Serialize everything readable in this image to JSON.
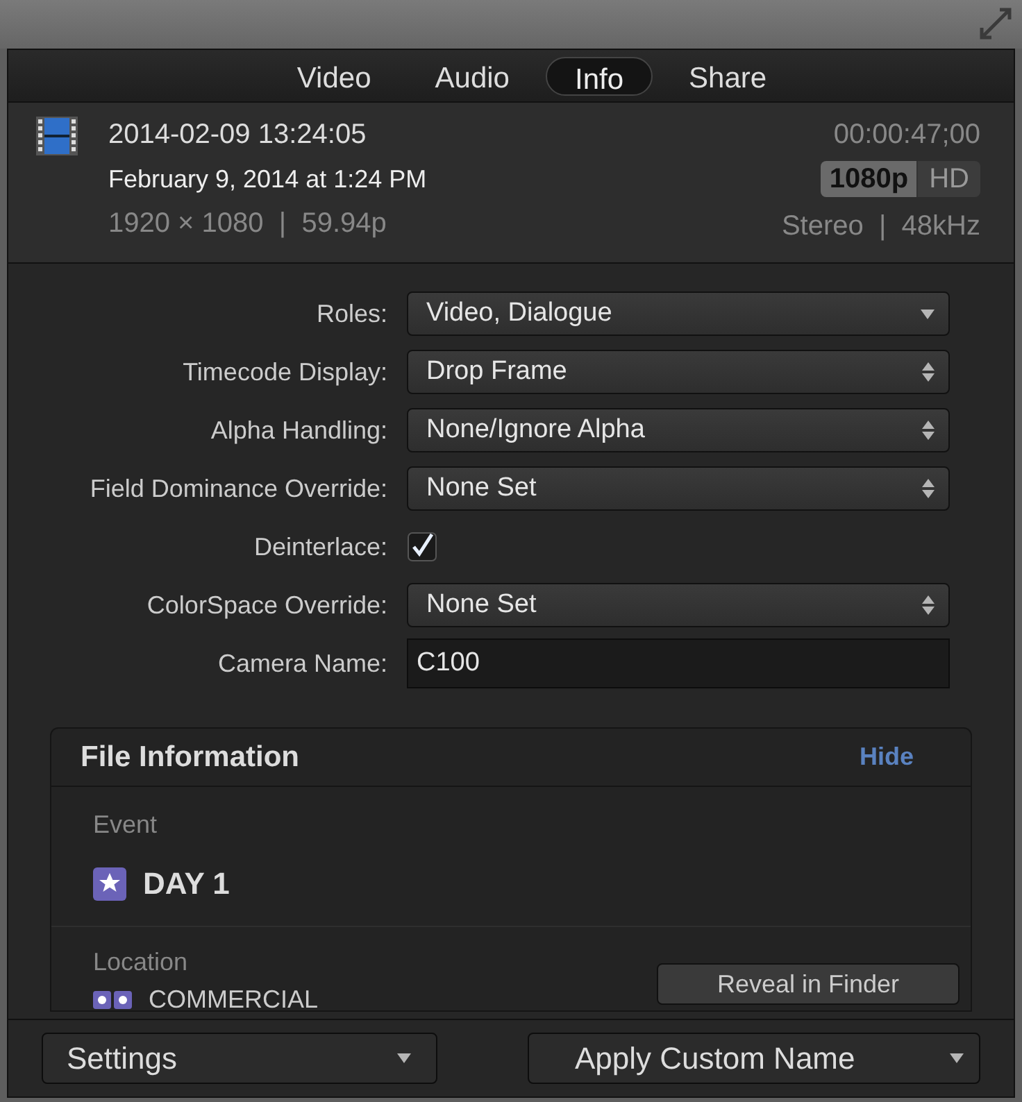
{
  "tabs": [
    {
      "label": "Video",
      "selected": false
    },
    {
      "label": "Audio",
      "selected": false
    },
    {
      "label": "Info",
      "selected": true
    },
    {
      "label": "Share",
      "selected": false
    }
  ],
  "clip": {
    "name": "2014-02-09 13:24:05",
    "date": "February 9, 2014 at 1:24 PM",
    "format": "1920 × 1080  |  59.94p",
    "duration": "00:00:47;00",
    "resolution": "1080p",
    "definition": "HD",
    "audio": "Stereo  |  48kHz"
  },
  "settings": [
    {
      "label": "Roles:",
      "kind": "menu",
      "value": "Video, Dialogue"
    },
    {
      "label": "Timecode Display:",
      "kind": "popup",
      "value": "Drop Frame"
    },
    {
      "label": "Alpha Handling:",
      "kind": "popup",
      "value": "None/Ignore Alpha"
    },
    {
      "label": "Field Dominance Override:",
      "kind": "popup",
      "value": "None Set"
    },
    {
      "label": "Deinterlace:",
      "kind": "checkbox",
      "checked": true
    },
    {
      "label": "ColorSpace Override:",
      "kind": "popup",
      "value": "None Set"
    },
    {
      "label": "Camera Name:",
      "kind": "text",
      "value": "C100"
    }
  ],
  "file_information": {
    "title": "File Information",
    "toggle": "Hide",
    "event_label": "Event",
    "event": "DAY 1",
    "location_label": "Location",
    "location": "COMMERCIAL",
    "reveal_button": "Reveal in Finder"
  },
  "footer": {
    "settings": "Settings",
    "apply": "Apply Custom Name"
  }
}
